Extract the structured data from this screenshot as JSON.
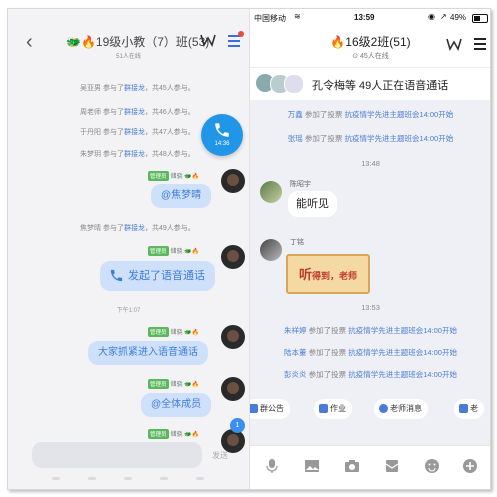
{
  "left": {
    "title": "19级小教（7）班(53)",
    "online": "51人在线",
    "events": [
      {
        "who": "吴亚男",
        "mid": "参与了",
        "link": "群接龙",
        "tail": "，共45人参与。"
      },
      {
        "who": "周老师",
        "mid": "参与了",
        "link": "群接龙",
        "tail": "，共46人参与。"
      },
      {
        "who": "于丹阳",
        "mid": "参与了",
        "link": "群接龙",
        "tail": "，共47人参与。"
      },
      {
        "who": "朱梦玥",
        "mid": "参与了",
        "link": "群接龙",
        "tail": "，共48人参与。"
      },
      {
        "who": "焦梦晴",
        "mid": "参与了",
        "link": "群接龙",
        "tail": "，共49人参与。"
      }
    ],
    "call_time": "14:36",
    "admin_badge": "管理员",
    "sender_name": "储骁",
    "messages": {
      "m1": "@焦梦晴",
      "m2": "发起了语音通话",
      "m3": "大家抓紧进入语音通话",
      "m4": "@全体成员"
    },
    "time_divider": "下午1:07",
    "notif_count": "1",
    "send_label": "发送"
  },
  "right": {
    "status": {
      "carrier": "中国移动",
      "time": "13:59",
      "battery": "49%"
    },
    "title": "16级2班(51)",
    "online": "45人在线",
    "voice_banner": "孔令梅等 49人正在语音通话",
    "vote_prefix": "参加了投票",
    "vote_link": "抗疫情学先进主题班会14:00开始",
    "top_voters": [
      "万鑫",
      "张瑶"
    ],
    "time1": "13:48",
    "chat": [
      {
        "name": "陈昭宇",
        "text": "能听见"
      },
      {
        "name": "丁铭",
        "text": "听得到，老师"
      }
    ],
    "sticker_big": "听",
    "sticker_small": "得到，老师",
    "time2": "13:53",
    "bottom_voters": [
      "朱祥婷",
      "陆本董",
      "彭炎炎"
    ],
    "tabs": [
      "群公告",
      "作业",
      "老师消息",
      "老"
    ],
    "colors": {
      "accent": "#4a7bd6",
      "bubble": "#cfe0fb",
      "admin": "#5cb85c"
    }
  }
}
